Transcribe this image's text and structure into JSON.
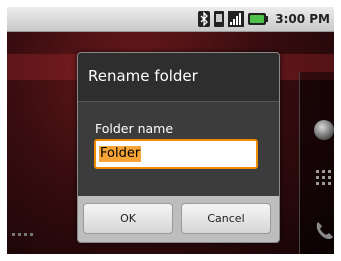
{
  "status_bar": {
    "time": "3:00 PM",
    "icons": [
      "bluetooth-icon",
      "vibrate-icon",
      "signal-icon",
      "battery-icon"
    ]
  },
  "dialog": {
    "title": "Rename folder",
    "field_label": "Folder name",
    "field_value": "Folder",
    "ok_label": "OK",
    "cancel_label": "Cancel"
  },
  "colors": {
    "accent": "#f08c00",
    "selection": "#f7a437",
    "wallpaper": "#3a0d10"
  }
}
